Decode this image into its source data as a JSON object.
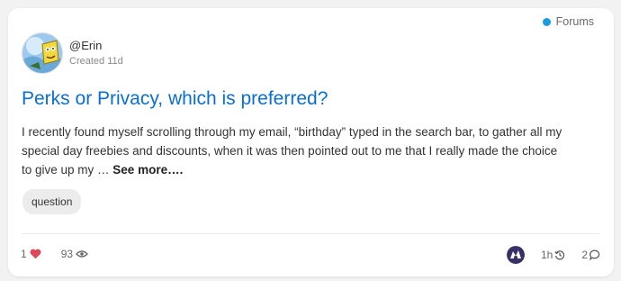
{
  "category": {
    "name": "Forums",
    "color": "#1a9de0"
  },
  "author": {
    "username": "@Erin",
    "created": "Created 11d"
  },
  "topic": {
    "title": "Perks or Privacy, which is preferred?",
    "excerpt": "I recently found myself scrolling through my email, “birthday” typed in the search bar, to gather all my special day freebies and discounts, when it was then pointed out to me that I really made the choice to give up my … ",
    "see_more": "See more…."
  },
  "tags": [
    "question"
  ],
  "stats": {
    "likes": "1",
    "views": "93",
    "last_activity": "1h",
    "replies": "2"
  },
  "icons": {
    "like": "heart-icon",
    "views": "eye-icon",
    "activity": "history-icon",
    "replies": "comment-icon"
  },
  "colors": {
    "title": "#0a6fd1",
    "heart": "#e0475b"
  }
}
